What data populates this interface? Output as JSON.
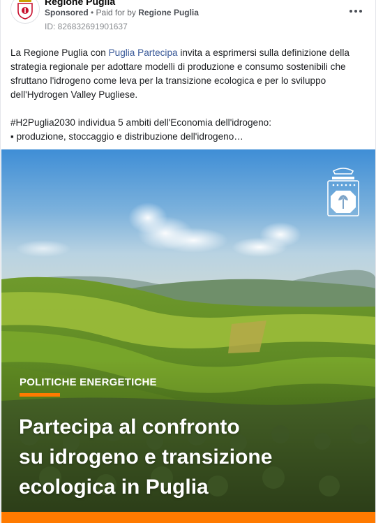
{
  "post": {
    "page_name": "Regione Puglia",
    "sponsored_label": "Sponsored",
    "paid_for_prefix": "• Paid for by",
    "paid_for_by": "Regione Puglia",
    "ad_id": "ID: 826832691901637",
    "more_icon": "more-dots-icon"
  },
  "body": {
    "intro_pre_link": "La Regione Puglia con ",
    "intro_link": "Puglia Partecipa",
    "intro_post_link": " invita a esprimersi sulla definizione della strategia regionale per adottare modelli di produzione e consumo sostenibili che sfruttano l'idrogeno come leva per la transizione ecologica e per lo sviluppo dell'Hydrogen Valley Pugliese.",
    "hashtag_line": "#H2Puglia2030 individua 5 ambiti dell'Economia dell'idrogeno:",
    "bullet_line": "▪ produzione, stoccaggio e distribuzione dell'idrogeno…"
  },
  "creative": {
    "kicker": "POLITICHE ENERGETICHE",
    "headline_lines": [
      "Partecipa al confronto",
      "su idrogeno e transizione",
      "ecologica in Puglia"
    ],
    "accent_color": "#ff7a00",
    "logo_icon": "regione-puglia-crest-icon"
  }
}
